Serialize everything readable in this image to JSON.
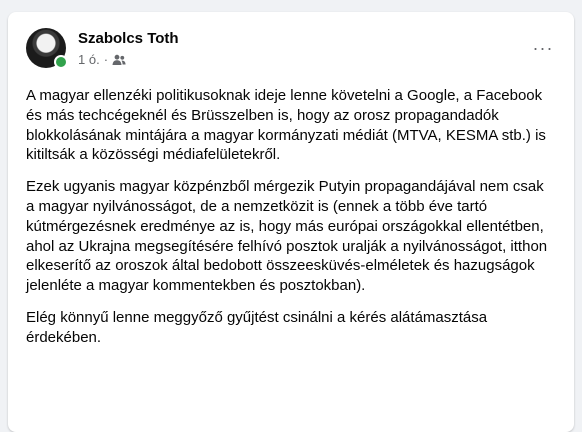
{
  "post": {
    "author": "Szabolcs Toth",
    "timestamp": "1 ó.",
    "separator": "·",
    "audience_icon": "friends-icon",
    "more_icon": "more-options-icon",
    "more_label": "···",
    "paragraphs": [
      "A magyar ellenzéki politikusoknak ideje lenne követelni a Google, a Facebook és más techcégeknél és Brüsszelben is, hogy az orosz propagandadók blokkolásának mintájára a magyar kormányzati médiát (MTVA, KESMA stb.) is kitiltsák a közösségi médiafelületekről.",
      "Ezek ugyanis magyar közpénzből mérgezik Putyin propagandájával nem csak a magyar nyilvánosságot, de a nemzetközit is (ennek a több éve tartó kútmérgezésnek eredménye az is, hogy más európai országokkal ellentétben, ahol az Ukrajna megsegítésére felhívó posztok uralják a nyilvánosságot, itthon elkeserítő az oroszok által bedobott összeesküvés-elméletek és hazugságok jelenléte a magyar kommentekben és posztokban).",
      "Elég könnyű lenne meggyőző gyűjtést csinálni a kérés alátámasztása érdekében."
    ]
  },
  "colors": {
    "background": "#f0f2f5",
    "card": "#ffffff",
    "secondary_text": "#65676b",
    "online": "#31a24c"
  }
}
